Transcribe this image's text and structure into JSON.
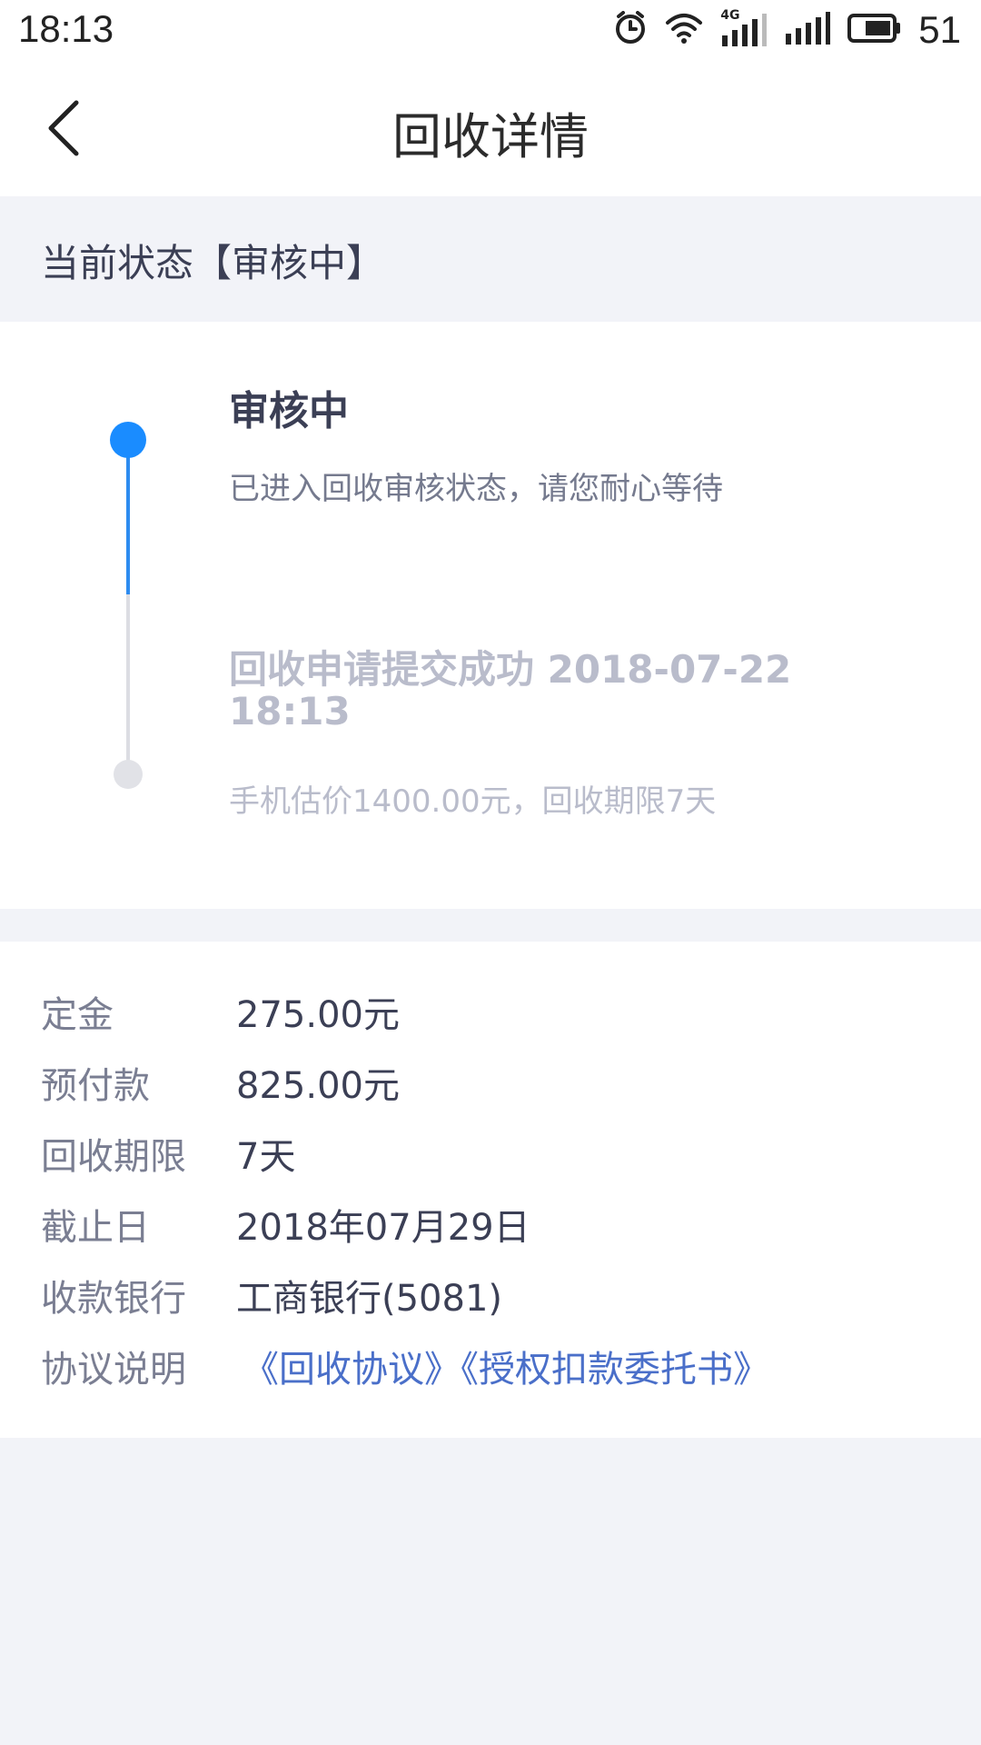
{
  "status_bar": {
    "time": "18:13",
    "battery_percent": "51",
    "network_label": "4G"
  },
  "nav": {
    "title": "回收详情"
  },
  "current_status": {
    "label": "当前状态【审核中】"
  },
  "timeline": {
    "steps": [
      {
        "title": "审核中",
        "description": "已进入回收审核状态，请您耐心等待",
        "active": true
      },
      {
        "title": "回收申请提交成功 2018-07-22 18:13",
        "description": "手机估价1400.00元，回收期限7天",
        "active": false
      }
    ],
    "colors": {
      "active": "#1a8cff",
      "inactive": "#e1e2e7"
    }
  },
  "details": {
    "rows": [
      {
        "label": "定金",
        "value": "275.00元"
      },
      {
        "label": "预付款",
        "value": "825.00元"
      },
      {
        "label": "回收期限",
        "value": "7天"
      },
      {
        "label": "截止日",
        "value": "2018年07月29日"
      },
      {
        "label": "收款银行",
        "value": "工商银行(5081)"
      }
    ],
    "agreement": {
      "label": "协议说明",
      "links": [
        "《回收协议》",
        "《授权扣款委托书》"
      ],
      "link_color": "#4a6fc9"
    }
  }
}
